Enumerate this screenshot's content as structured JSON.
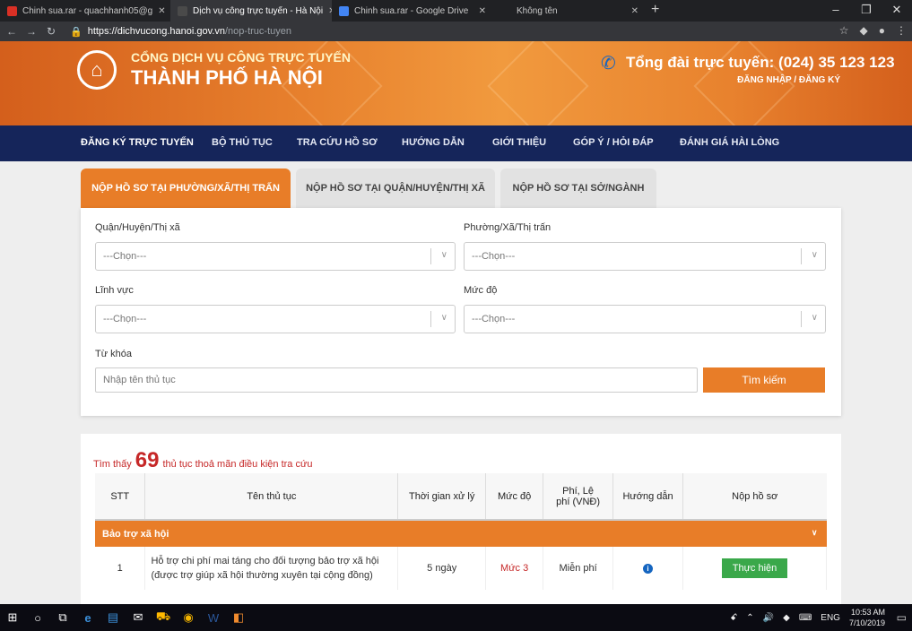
{
  "browser": {
    "tabs": [
      {
        "label": "Chinh sua.rar - quachhanh05@g",
        "active": false,
        "favicon_color": "#d93025"
      },
      {
        "label": "Dịch vụ công trực tuyến - Hà Nội",
        "active": true,
        "favicon_color": "#4a4a4a"
      },
      {
        "label": "Chinh sua.rar - Google Drive",
        "active": false,
        "favicon_color": "#4285f4"
      },
      {
        "label": "Không tên",
        "active": false,
        "favicon_color": "#35363a"
      }
    ],
    "url_host": "https://dichvucong.hanoi.gov.vn",
    "url_path": "/nop-truc-tuyen"
  },
  "header": {
    "portal_name": "CỔNG DỊCH VỤ CÔNG TRỰC TUYẾN",
    "city_name": "THÀNH PHỐ HÀ NỘI",
    "hotline": "Tổng đài trực tuyến: (024) 35 123 123",
    "auth": "ĐĂNG NHẬP / ĐĂNG KÝ"
  },
  "nav": [
    "ĐĂNG KÝ TRỰC TUYẾN",
    "BỘ THỦ TỤC",
    "TRA CỨU HỒ SƠ",
    "HƯỚNG DẪN",
    "GIỚI THIỆU",
    "GÓP Ý / HỎI ĐÁP",
    "ĐÁNH GIÁ HÀI LÒNG"
  ],
  "tabs": [
    "NỘP HỒ SƠ TẠI PHƯỜNG/XÃ/THỊ TRẤN",
    "NỘP HỒ SƠ TẠI QUẬN/HUYỆN/THỊ XÃ",
    "NỘP HỒ SƠ TẠI SỞ/NGÀNH"
  ],
  "form": {
    "district_label": "Quận/Huyện/Thị xã",
    "ward_label": "Phường/Xã/Thị trấn",
    "field_label": "Lĩnh vực",
    "level_label": "Mức độ",
    "keyword_label": "Từ khóa",
    "select_placeholder": "---Chọn---",
    "keyword_placeholder": "Nhập tên thủ tục",
    "search_button": "Tìm kiếm"
  },
  "results": {
    "prefix": "Tìm thấy",
    "count": "69",
    "suffix": "thủ tục thoả mãn điều kiện tra cứu",
    "headers": [
      "STT",
      "Tên thủ tục",
      "Thời gian xử lý",
      "Mức độ",
      "Phí, Lệ phí (VNĐ)",
      "Hướng dẫn",
      "Nộp hồ sơ"
    ],
    "group": "Bảo trợ xã hội",
    "row": {
      "stt": "1",
      "name": "Hỗ trợ chi phí mai táng cho đối tượng bảo trợ xã hội (được trợ giúp xã hội thường xuyên tại cộng đồng)",
      "time": "5 ngày",
      "level": "Mức 3",
      "fee": "Miễn phí",
      "action": "Thực hiện"
    }
  },
  "taskbar": {
    "lang": "ENG",
    "time": "10:53 AM",
    "date": "7/10/2019"
  },
  "colors": {
    "accent": "#e87d28",
    "nav_bg": "#15255a",
    "action_green": "#3aa84a",
    "level_red": "#c62828"
  }
}
